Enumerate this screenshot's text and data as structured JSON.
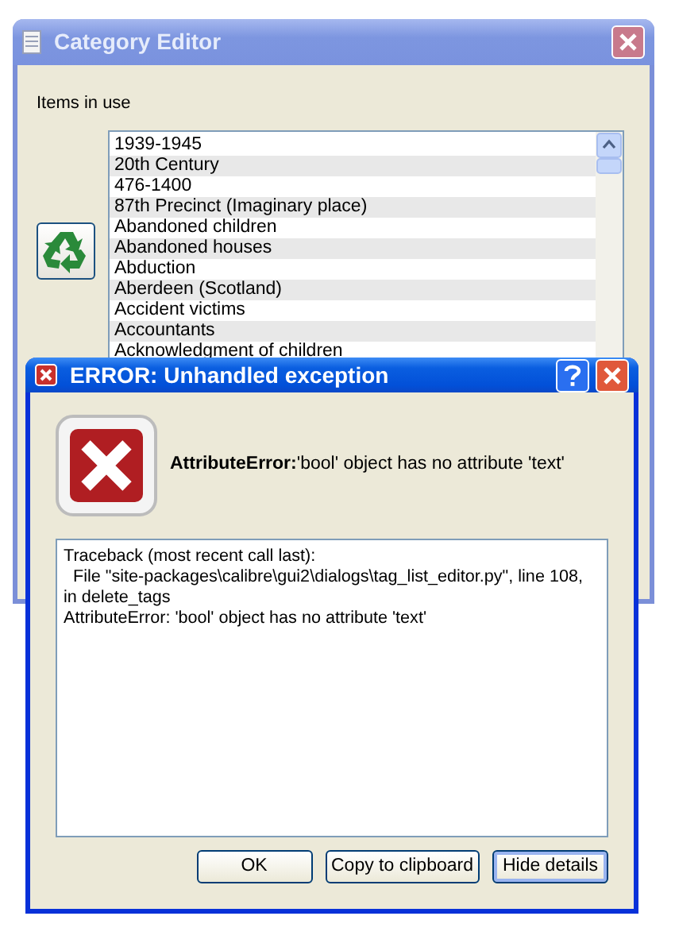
{
  "background_window": {
    "title": "Category Editor",
    "items_label": "Items in use",
    "items": [
      "1939-1945",
      "20th Century",
      "476-1400",
      "87th Precinct (Imaginary place)",
      "Abandoned children",
      "Abandoned houses",
      "Abduction",
      "Aberdeen (Scotland)",
      "Accident victims",
      "Accountants",
      "Acknowledgment of children"
    ]
  },
  "error_dialog": {
    "title": "ERROR: Unhandled exception",
    "message": "**AttributeError:**'bool' object has no attribute 'text'",
    "details": "Traceback (most recent call last):\n  File \"site-packages\\calibre\\gui2\\dialogs\\tag_list_editor.py\", line 108, in delete_tags\nAttributeError: 'bool' object has no attribute 'text'",
    "buttons": [
      {
        "label": "OK",
        "default": false
      },
      {
        "label": "Copy to clipboard",
        "default": false
      },
      {
        "label": "Hide details",
        "default": true
      }
    ]
  }
}
